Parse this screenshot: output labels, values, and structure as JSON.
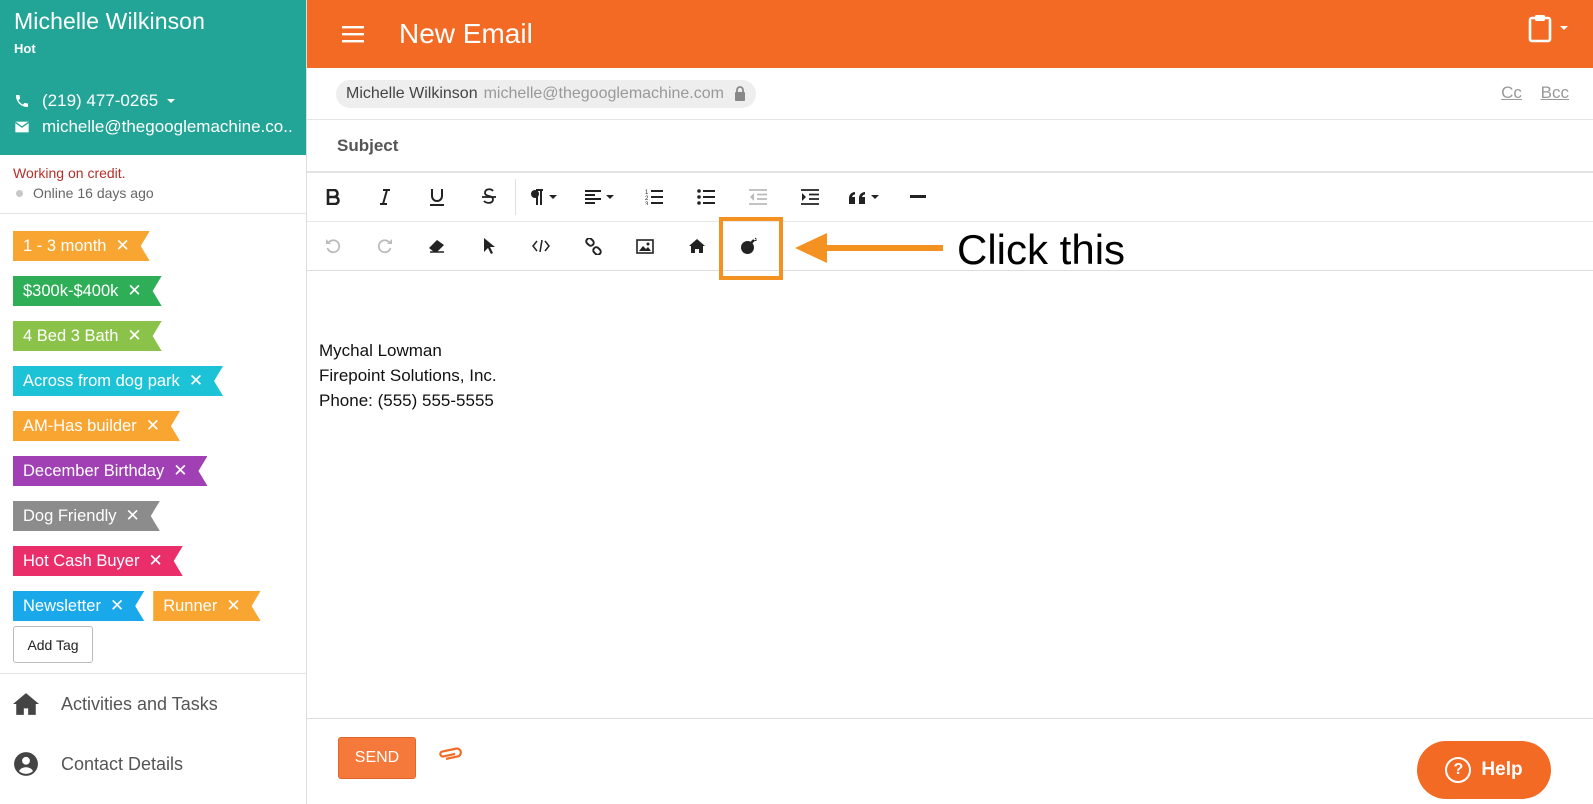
{
  "contact": {
    "name": "Michelle Wilkinson",
    "status": "Hot",
    "phone": "(219) 477-0265",
    "email": "michelle@thegooglemachine.co...",
    "note": "Working on credit.",
    "online": "Online 16 days ago"
  },
  "tags": [
    {
      "label": "1 - 3 month",
      "color": "#f9a531"
    },
    {
      "label": "$300k-$400k",
      "color": "#2fae58"
    },
    {
      "label": "4 Bed 3 Bath",
      "color": "#8bc34a"
    },
    {
      "label": "Across from dog park",
      "color": "#1cc2d6"
    },
    {
      "label": "AM-Has builder",
      "color": "#f9a531"
    },
    {
      "label": "December Birthday",
      "color": "#a13fb5"
    },
    {
      "label": "Dog Friendly",
      "color": "#8c8c8c"
    },
    {
      "label": "Hot Cash Buyer",
      "color": "#ea2e6a"
    },
    {
      "label": "Newsletter",
      "color": "#19a9ea"
    },
    {
      "label": "Runner",
      "color": "#f9a531"
    }
  ],
  "tag_remove_glyph": "✕",
  "add_tag_label": "Add Tag",
  "nav": {
    "activities": "Activities and Tasks",
    "contact_details": "Contact Details"
  },
  "header": {
    "title": "New Email"
  },
  "compose": {
    "to_name": "Michelle Wilkinson",
    "to_email": "michelle@thegooglemachine.com",
    "cc": "Cc",
    "bcc": "Bcc",
    "subject_placeholder": "Subject",
    "signature": [
      "Mychal Lowman",
      "Firepoint Solutions, Inc.",
      "Phone: (555) 555-5555"
    ]
  },
  "annotation": {
    "text": "Click this",
    "color": "#f39221"
  },
  "footer": {
    "send_label": "SEND",
    "help_label": "Help",
    "help_glyph": "?"
  },
  "colors": {
    "sidebar_header": "#22a596",
    "topbar": "#f26a24",
    "send": "#f5793a"
  }
}
